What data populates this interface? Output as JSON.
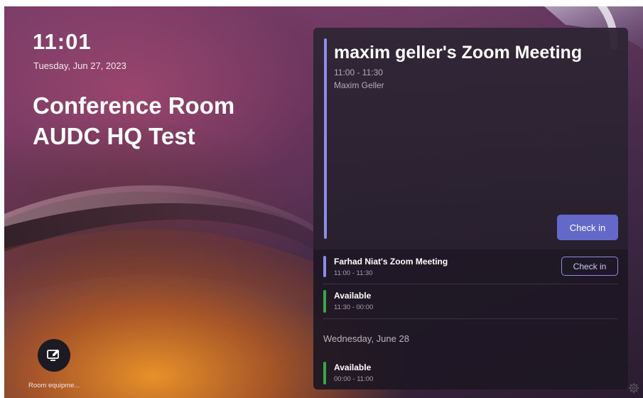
{
  "clock": {
    "time": "11:01",
    "date": "Tuesday, Jun 27, 2023"
  },
  "room": {
    "name": "Conference Room AUDC HQ Test"
  },
  "current_meeting": {
    "title": "maxim geller's Zoom Meeting",
    "time": "11:00 - 11:30",
    "organizer": "Maxim Geller",
    "check_in_label": "Check in",
    "accent": "#8d8de8"
  },
  "agenda": {
    "items": [
      {
        "title": "Farhad Niat's Zoom Meeting",
        "time": "11:00 - 11:30",
        "check_in_label": "Check in",
        "accent": "#8d8de8"
      },
      {
        "title": "Available",
        "time": "11:30 - 00:00",
        "accent": "#3aa64a"
      }
    ],
    "next_day": {
      "heading": "Wednesday, June 28",
      "items": [
        {
          "title": "Available",
          "time": "00:00 - 11:00",
          "accent": "#3aa64a"
        }
      ]
    }
  },
  "equipment": {
    "label": "Room equipme...",
    "icon": "edit-monitor-icon"
  },
  "settings": {
    "icon": "settings-gear-icon"
  },
  "colors": {
    "button_primary": "#6468c8",
    "available": "#3aa64a",
    "meeting": "#8d8de8"
  }
}
